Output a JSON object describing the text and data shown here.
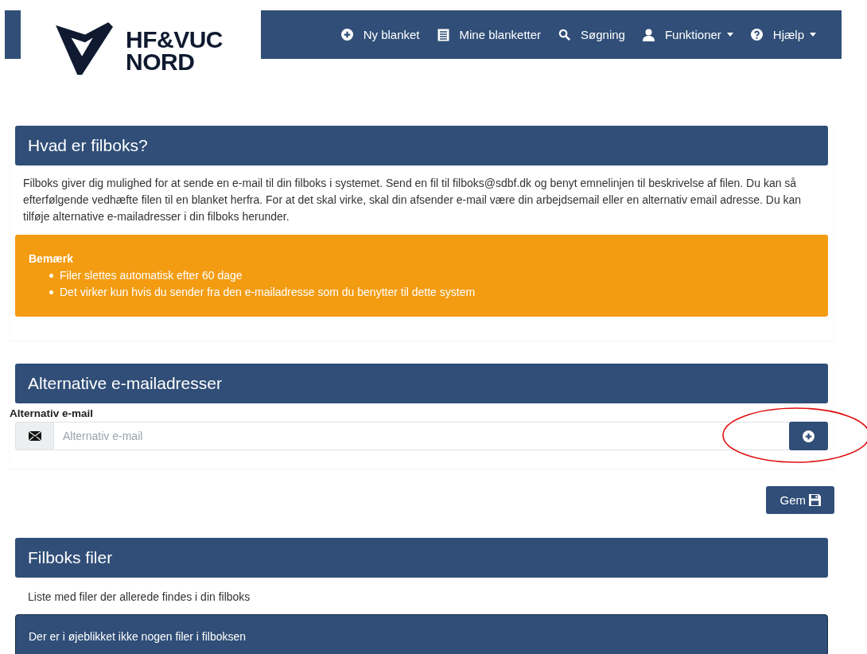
{
  "logo": {
    "line_1": "HF&VUC",
    "line_2": "NORD"
  },
  "nav": [
    {
      "label": "Ny blanket",
      "dropdown": false
    },
    {
      "label": "Mine blanketter",
      "dropdown": false
    },
    {
      "label": "Søgning",
      "dropdown": false
    },
    {
      "label": "Funktioner",
      "dropdown": true
    },
    {
      "label": "Hjælp",
      "dropdown": true
    }
  ],
  "about": {
    "title": "Hvad er filboks?",
    "text": "Filboks giver dig mulighed for at sende en e-mail til din filboks i systemet. Send en fil til filboks@sdbf.dk og benyt emnelinjen til beskrivelse af filen. Du kan så efterfølgende vedhæfte filen til en blanket herfra. For at det skal virke, skal din afsender e-mail være din arbejdsemail eller en alternativ email adresse. Du kan tilføje alternative e-mailadresser i din filboks herunder.",
    "notice": {
      "title": "Bemærk",
      "items": [
        "Filer slettes automatisk efter 60 dage",
        "Det virker kun hvis du sender fra den e-mailadresse som du benytter til dette system"
      ]
    }
  },
  "alternatives": {
    "title": "Alternative e-mailadresser",
    "field_label": "Alternativ e-mail",
    "placeholder": "Alternativ e-mail"
  },
  "save_button": "Gem",
  "files": {
    "title": "Filboks filer",
    "text": "Liste med filer der allerede findes i din filboks",
    "empty_message": "Der er i øjeblikket ikke nogen filer i filboksen"
  }
}
